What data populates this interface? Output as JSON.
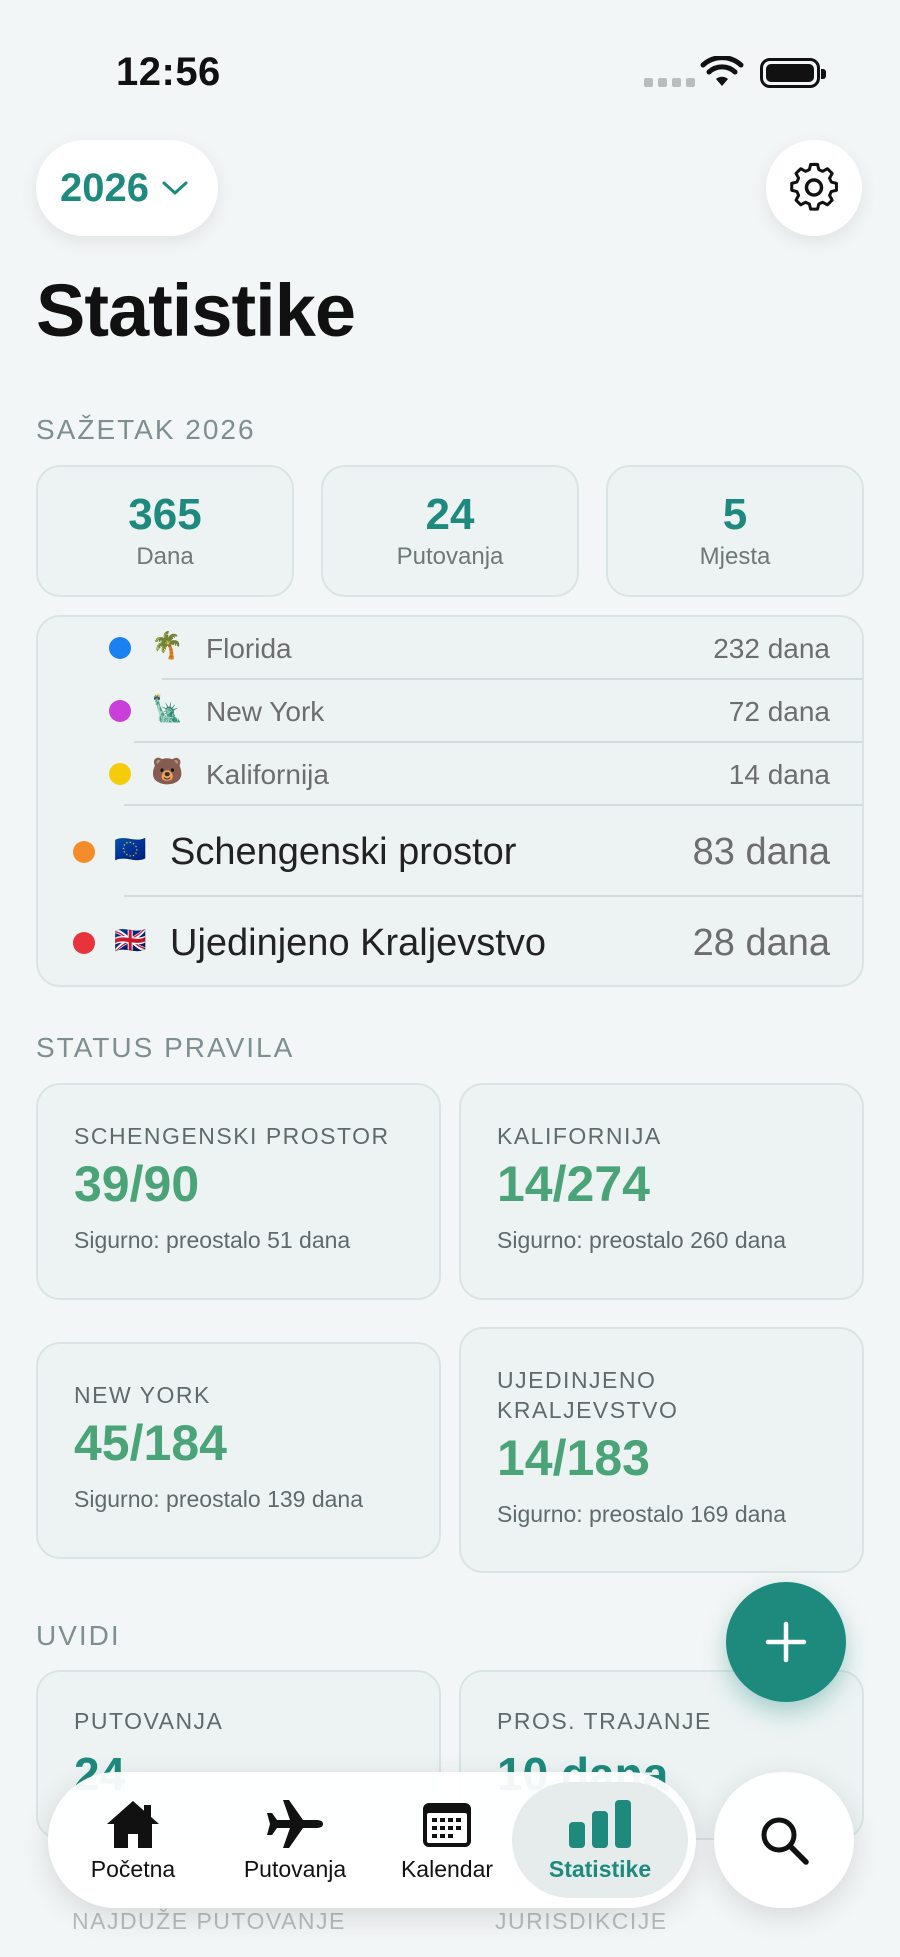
{
  "status_bar": {
    "time": "12:56"
  },
  "header": {
    "year": "2026",
    "title": "Statistike"
  },
  "summary": {
    "label": "SAŽETAK 2026",
    "stats": [
      {
        "value": "365",
        "label": "Dana"
      },
      {
        "value": "24",
        "label": "Putovanja"
      },
      {
        "value": "5",
        "label": "Mjesta"
      }
    ]
  },
  "jurisdictions": [
    {
      "name": "Florida",
      "days": "232 dana",
      "flag": "🌴",
      "color": "#1a82f0",
      "level": "sub"
    },
    {
      "name": "New York",
      "days": "72 dana",
      "flag": "🗽",
      "color": "#c93fd9",
      "level": "sub"
    },
    {
      "name": "Kalifornija",
      "days": "14 dana",
      "flag": "🐻",
      "color": "#f5cc0a",
      "level": "sub"
    },
    {
      "name": "Schengenski prostor",
      "days": "83 dana",
      "flag": "🇪🇺",
      "color": "#f58c2c",
      "level": "main"
    },
    {
      "name": "Ujedinjeno Kraljevstvo",
      "days": "28 dana",
      "flag": "🇬🇧",
      "color": "#e8323c",
      "level": "main"
    }
  ],
  "rules": {
    "label": "STATUS PRAVILA",
    "cards": [
      {
        "title": "SCHENGENSKI PROSTOR",
        "value": "39/90",
        "note": "Sigurno: preostalo 51 dana"
      },
      {
        "title": "KALIFORNIJA",
        "value": "14/274",
        "note": "Sigurno: preostalo 260 dana"
      },
      {
        "title": "NEW YORK",
        "value": "45/184",
        "note": "Sigurno: preostalo 139 dana"
      },
      {
        "title": "UJEDINJENO KRALJEVSTVO",
        "value": "14/183",
        "note": "Sigurno: preostalo 169 dana"
      }
    ]
  },
  "insights": {
    "label": "UVIDI",
    "cards": [
      {
        "title": "PUTOVANJA",
        "value": "24"
      },
      {
        "title": "PROS. TRAJANJE",
        "value": "10 dana"
      }
    ],
    "next_labels": [
      "NAJDUŽE PUTOVANJE",
      "JURISDIKCIJE"
    ]
  },
  "tabbar": {
    "tabs": [
      {
        "label": "Početna",
        "icon": "house-icon"
      },
      {
        "label": "Putovanja",
        "icon": "airplane-icon"
      },
      {
        "label": "Kalendar",
        "icon": "calendar-icon"
      },
      {
        "label": "Statistike",
        "icon": "chart-bars-icon",
        "active": true
      }
    ]
  },
  "colors": {
    "accent": "#1e8a7e",
    "safe_green": "#4aa477",
    "background": "#f3f6f6"
  }
}
